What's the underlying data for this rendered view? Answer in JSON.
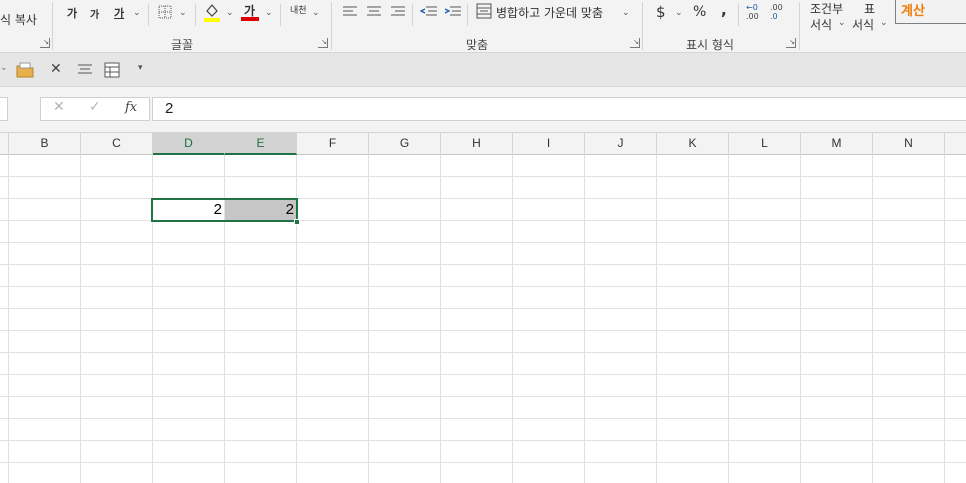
{
  "ribbon": {
    "clipboard_partial": "식 복사",
    "font_group_label": "글꼴",
    "grow_font": "가",
    "shrink_font": "가",
    "font_style": "가",
    "font_color_char": "가",
    "phonetic": "내천",
    "align_group_label": "맞춤",
    "merge_center": "병합하고 가운데 맞춤",
    "number_group_label": "표시 형식",
    "currency": "$",
    "percent": "%",
    "comma": ",",
    "increase_decimal": ".00",
    "decrease_decimal": ".0",
    "cond_format_line1": "조건부",
    "cond_format_line2": "서식",
    "table_format_line1": "표",
    "table_format_line2": "서식",
    "cell_style": "계산",
    "colors": {
      "fill": "#ffff00",
      "font": "#e00000",
      "accent": "#217346",
      "style_text": "#f07f09"
    }
  },
  "formula_bar": {
    "cancel": "✕",
    "enter": "✓",
    "fx": "fx",
    "value": "2"
  },
  "columns": [
    "B",
    "C",
    "D",
    "E",
    "F",
    "G",
    "H",
    "I",
    "J",
    "K",
    "L",
    "M",
    "N"
  ],
  "selected_columns": [
    "D",
    "E"
  ],
  "cells": {
    "D": "2",
    "E": "2"
  }
}
